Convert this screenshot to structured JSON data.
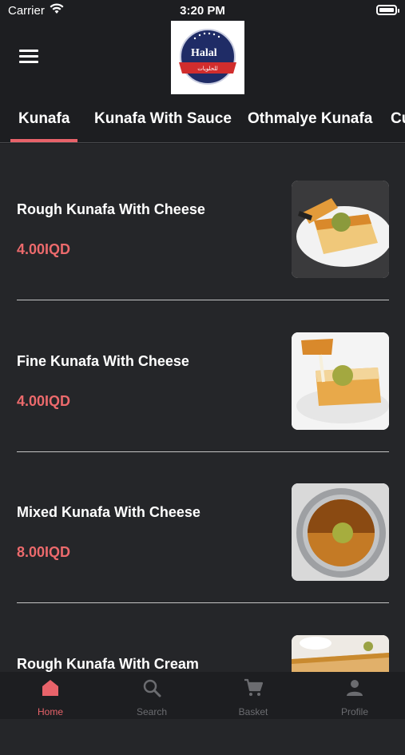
{
  "status_bar": {
    "carrier": "Carrier",
    "time": "3:20 PM"
  },
  "logo": {
    "text": "Halal",
    "subtitle": "للحلويات"
  },
  "tabs": [
    {
      "label": "Kunafa"
    },
    {
      "label": "Kunafa With Sauce"
    },
    {
      "label": "Othmalye Kunafa"
    },
    {
      "label": "Cu"
    }
  ],
  "items": [
    {
      "name": "Rough Kunafa With Cheese",
      "price": "4.00IQD"
    },
    {
      "name": "Fine Kunafa With Cheese",
      "price": "4.00IQD"
    },
    {
      "name": "Mixed Kunafa With Cheese",
      "price": "8.00IQD"
    },
    {
      "name": "Rough Kunafa With Cream",
      "price": ""
    }
  ],
  "bottom_nav": [
    {
      "label": "Home",
      "icon": "home-icon"
    },
    {
      "label": "Search",
      "icon": "search-icon"
    },
    {
      "label": "Basket",
      "icon": "cart-icon"
    },
    {
      "label": "Profile",
      "icon": "profile-icon"
    }
  ],
  "colors": {
    "accent": "#e8636a",
    "price": "#ec6a6c",
    "background": "#252629",
    "bar": "#1d1e21"
  }
}
